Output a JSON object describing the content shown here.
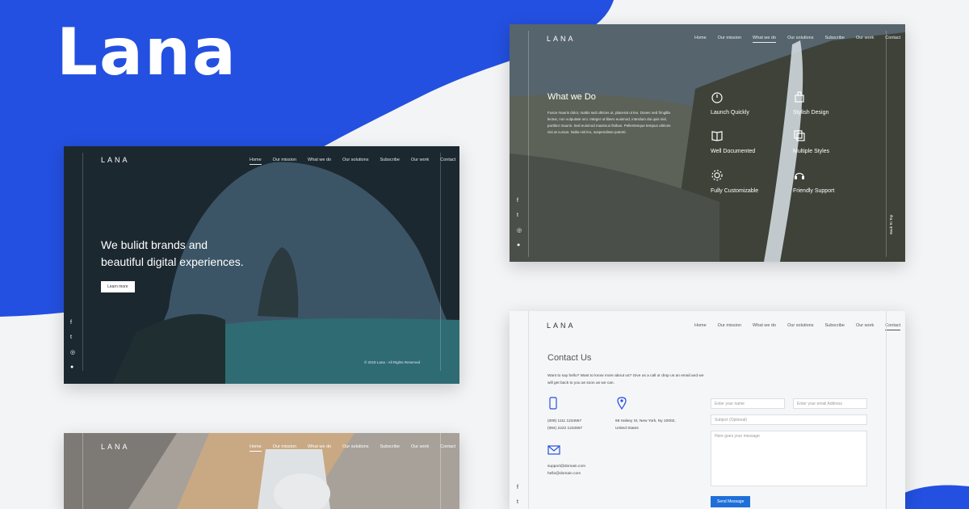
{
  "brand": {
    "title": "Lana"
  },
  "colors": {
    "accent": "#2350e0",
    "button": "#1e6fd9"
  },
  "card_home": {
    "logo": "LANA",
    "nav": [
      "Home",
      "Our mission",
      "What we do",
      "Our solutions",
      "Subscribe",
      "Our work",
      "Contact"
    ],
    "headline_line1": "We bulidt brands and",
    "headline_line2": "beautiful digital experiences.",
    "cta": "Learn more",
    "footer": "© 2018 Lana - All Rights Reserved",
    "social_icons": [
      "facebook-icon",
      "twitter-icon",
      "instagram-icon",
      "pinterest-icon"
    ]
  },
  "card_what": {
    "logo": "LANA",
    "nav": [
      "Home",
      "Our mission",
      "What we do",
      "Our solutions",
      "Subscribe",
      "Our work",
      "Contact"
    ],
    "heading": "What we Do",
    "body": "Fusce mauris dolor, mattis sed ultrices ut, placerat ut leo. Donec sed fringilla lectus, non vulputate orci. Integer ut libero euismod, interdum dui quis nisl, porttitor mauris. Sed euismod maximus finibus. Pellentesque tempus ultrices nisi at cursus. Nulla nisl leo, suspendisse potenti.",
    "features": [
      {
        "label": "Launch Quickly",
        "icon": "timer-icon"
      },
      {
        "label": "Stylish Design",
        "icon": "brush-icon"
      },
      {
        "label": "Well Documented",
        "icon": "book-icon"
      },
      {
        "label": "Multiple Styles",
        "icon": "layers-icon"
      },
      {
        "label": "Fully Customizable",
        "icon": "gear-icon"
      },
      {
        "label": "Friendly Support",
        "icon": "headset-icon"
      }
    ],
    "back_to_top": "Back To Top"
  },
  "card_contact": {
    "logo": "LANA",
    "nav": [
      "Home",
      "Our mission",
      "What we do",
      "Our solutions",
      "Subscribe",
      "Our work",
      "Contact"
    ],
    "heading": "Contact Us",
    "intro": "Want to say hello? Want to know more about us? Give us a call or drop us an email and we will get back to you as soon as we can.",
    "phone1": "(009) 1111 1234567",
    "phone2": "(084) 2222 1234567",
    "address1": "69 Halsey St, New York, Ny 10002,",
    "address2": "United States",
    "email1": "support@domain.com",
    "email2": "hello@domain.com",
    "name_placeholder": "Enter your name",
    "email_placeholder": "Enter your email Address",
    "subject_placeholder": "Subject (Optional)",
    "message_placeholder": "Here goes your message",
    "send": "Send Message"
  },
  "card_bottom": {
    "logo": "LANA",
    "nav": [
      "Home",
      "Our mission",
      "What we do",
      "Our solutions",
      "Subscribe",
      "Our work",
      "Contact"
    ]
  }
}
